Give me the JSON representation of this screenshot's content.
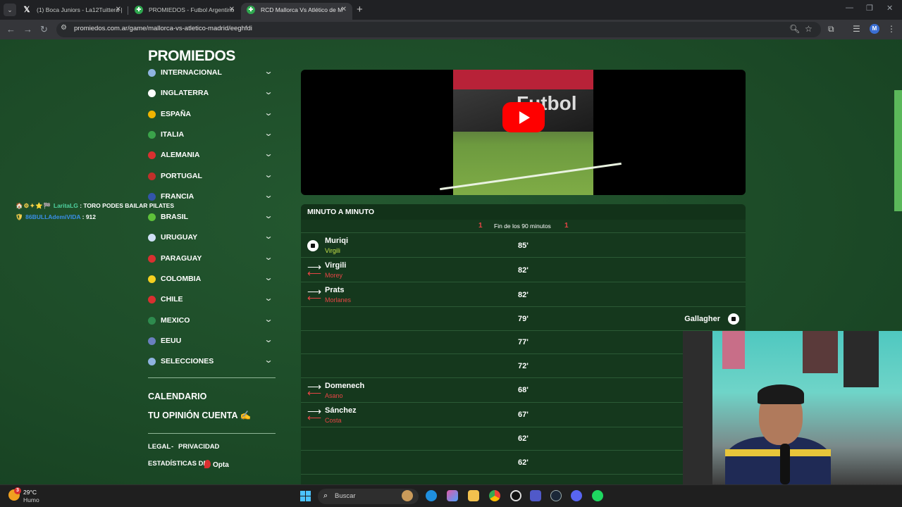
{
  "browser": {
    "tabs": [
      {
        "label": "(1) Boca Juniors - La12Tuittera |",
        "favicon": "x-icon"
      },
      {
        "label": "PROMIEDOS - Futbol Argentino",
        "favicon": "promiedos-icon"
      },
      {
        "label": "RCD Mallorca Vs Atlético de M",
        "favicon": "promiedos-icon",
        "active": true
      }
    ],
    "url": "promiedos.com.ar/game/mallorca-vs-atletico-madrid/eeghfdi",
    "profile_initial": "M"
  },
  "site": {
    "logo": "PROMIEDOS",
    "menu": [
      {
        "label": "INTERNACIONAL",
        "flag_color": "#8fb3e0"
      },
      {
        "label": "INGLATERRA",
        "flag_color": "#ffffff"
      },
      {
        "label": "ESPAÑA",
        "flag_color": "#f0b400"
      },
      {
        "label": "ITALIA",
        "flag_color": "#3aa34a"
      },
      {
        "label": "ALEMANIA",
        "flag_color": "#d93030"
      },
      {
        "label": "PORTUGAL",
        "flag_color": "#c0302a"
      },
      {
        "label": "FRANCIA",
        "flag_color": "#3355aa"
      },
      {
        "label": "BRASIL",
        "flag_color": "#5ec03a"
      },
      {
        "label": "URUGUAY",
        "flag_color": "#cfe0f5"
      },
      {
        "label": "PARAGUAY",
        "flag_color": "#d93030"
      },
      {
        "label": "COLOMBIA",
        "flag_color": "#f5d020"
      },
      {
        "label": "CHILE",
        "flag_color": "#d93030"
      },
      {
        "label": "MEXICO",
        "flag_color": "#2e8b4e"
      },
      {
        "label": "EEUU",
        "flag_color": "#6a7fbf"
      },
      {
        "label": "SELECCIONES",
        "flag_color": "#8fb3e0"
      }
    ],
    "calendario": "CALENDARIO",
    "opinion": "TU OPINIÓN CUENTA ✍️",
    "legal": "LEGAL",
    "legal_sep": "-",
    "privacidad": "PRIVACIDAD",
    "estadisticas": "ESTADÍSTICAS DE",
    "opta": "Opta"
  },
  "chat": [
    {
      "badges": "🏠⚙✦⭐🏁",
      "user": "LaritaLG",
      "message": ": TORO PODES BAILAR PILATES"
    },
    {
      "badges": "🛡",
      "user": "86BULLAdemiVIDA",
      "message": ": 912"
    }
  ],
  "video": {
    "brand_text": "Futbol"
  },
  "minuto_a_minuto": {
    "title": "MINUTO A MINUTO",
    "score_home": "1",
    "score_away": "1",
    "status": "Fin de los 90 minutos",
    "events": [
      {
        "type": "goal",
        "side": "home",
        "player": "Muriqi",
        "detail": "Virgili",
        "minute": "85'"
      },
      {
        "type": "sub",
        "side": "home",
        "player": "Virgili",
        "detail": "Morey",
        "minute": "82'"
      },
      {
        "type": "sub",
        "side": "home",
        "player": "Prats",
        "detail": "Morlanes",
        "minute": "82'"
      },
      {
        "type": "goal",
        "side": "away",
        "player": "Gallagher",
        "detail": "",
        "minute": "79'"
      },
      {
        "type": "none",
        "side": "",
        "player": "",
        "detail": "",
        "minute": "77'"
      },
      {
        "type": "none",
        "side": "",
        "player": "",
        "detail": "",
        "minute": "72'"
      },
      {
        "type": "sub",
        "side": "home",
        "player": "Domenech",
        "detail": "Asano",
        "minute": "68'"
      },
      {
        "type": "sub",
        "side": "home",
        "player": "Sánchez",
        "detail": "Costa",
        "minute": "67'"
      },
      {
        "type": "none",
        "side": "",
        "player": "",
        "detail": "",
        "minute": "62'"
      },
      {
        "type": "none",
        "side": "",
        "player": "",
        "detail": "",
        "minute": "62'"
      }
    ]
  },
  "taskbar": {
    "notification_count": "3",
    "temperature": "29°C",
    "condition": "Humo",
    "search_placeholder": "Buscar"
  }
}
